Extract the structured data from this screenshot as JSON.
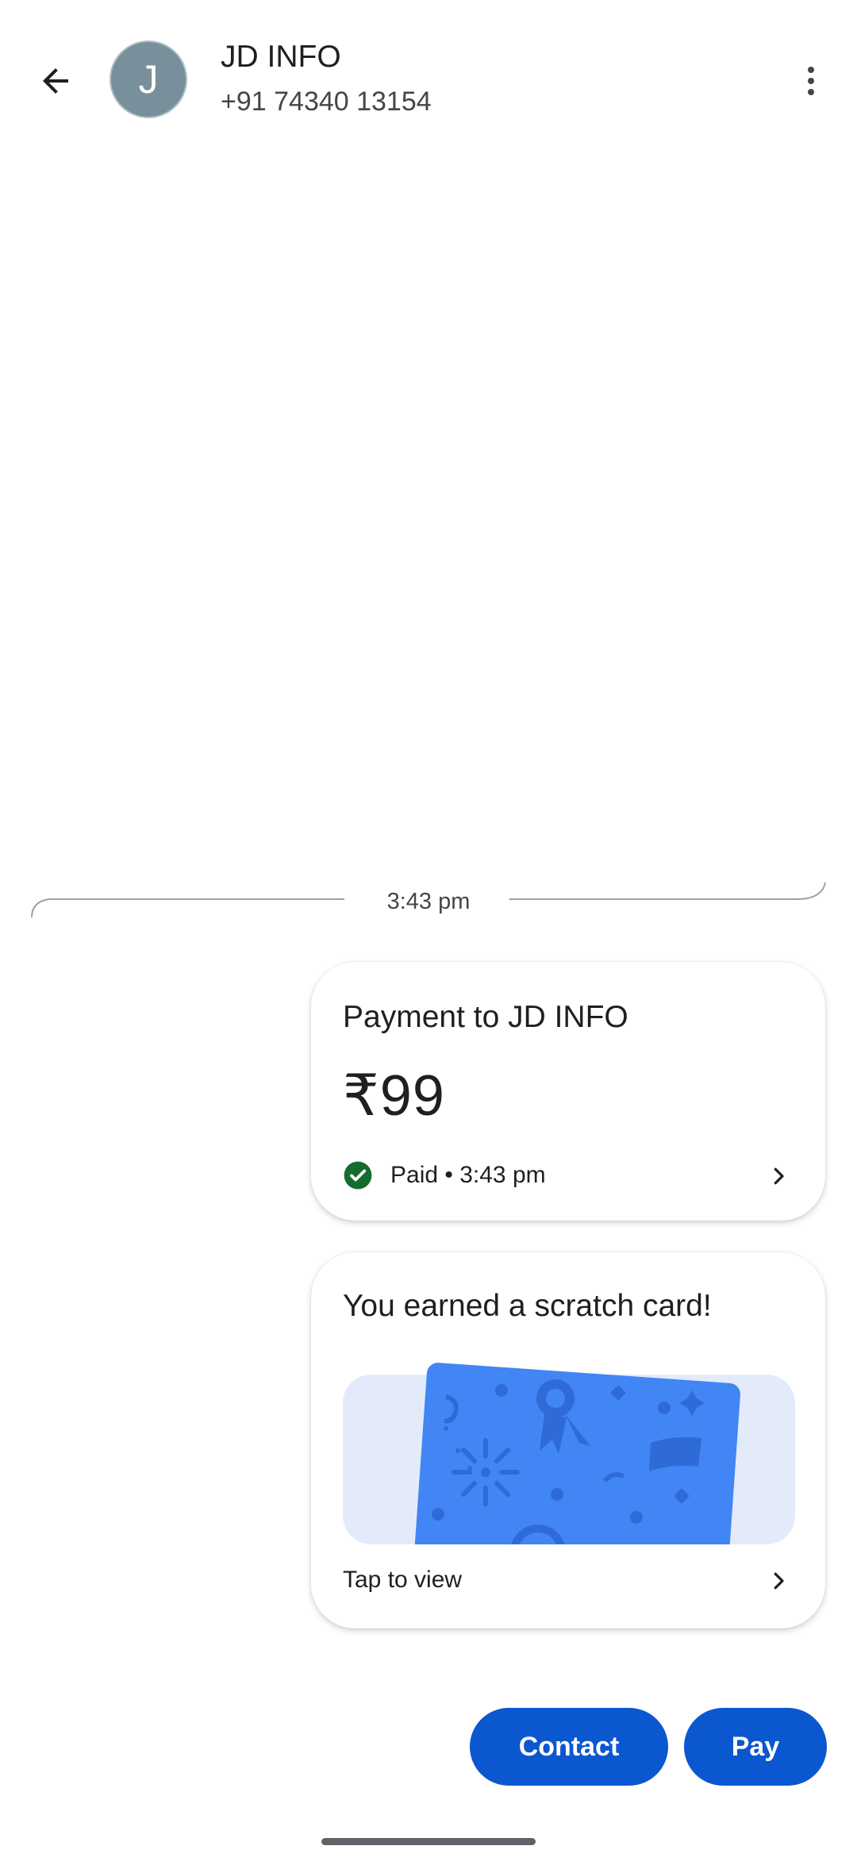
{
  "header": {
    "avatar_letter": "J",
    "contact_name": "JD INFO",
    "contact_phone": "+91 74340 13154",
    "back_icon": "arrow-left-icon",
    "more_icon": "more-vert-icon"
  },
  "conversation": {
    "timestamp": "3:43 pm"
  },
  "payment_card": {
    "title": "Payment to JD INFO",
    "amount": "₹99",
    "status": "Paid • 3:43 pm",
    "status_icon": "check-circle-icon",
    "status_color": "#146c2e"
  },
  "scratch_card": {
    "title": "You earned a scratch card!",
    "action_text": "Tap to view",
    "card_color": "#4285f4",
    "card_bg_color": "#e3ebfb"
  },
  "actions": {
    "contact_label": "Contact",
    "pay_label": "Pay",
    "button_color": "#0b57d0"
  }
}
